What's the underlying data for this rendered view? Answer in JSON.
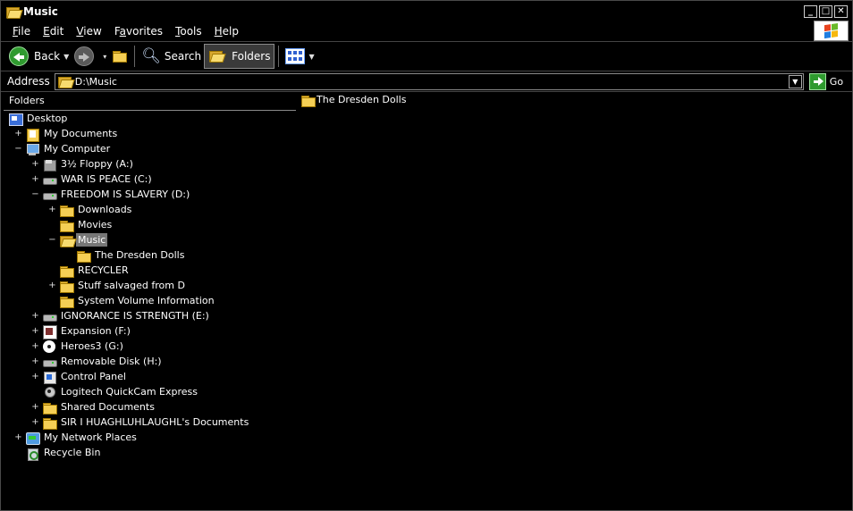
{
  "window": {
    "title": "Music"
  },
  "menu": [
    "File",
    "Edit",
    "View",
    "Favorites",
    "Tools",
    "Help"
  ],
  "menu_underline": [
    "F",
    "E",
    "V",
    "a",
    "T",
    "H"
  ],
  "toolbar": {
    "back": "Back",
    "search": "Search",
    "folders": "Folders"
  },
  "address": {
    "label": "Address",
    "value": "D:\\Music",
    "go": "Go"
  },
  "folders_pane": {
    "title": "Folders"
  },
  "tree": [
    {
      "label": "Desktop",
      "icon": "desktop-icon",
      "expander": ""
    },
    {
      "label": "My Documents",
      "icon": "my-documents-icon",
      "expander": "+"
    },
    {
      "label": "My Computer",
      "icon": "my-computer-icon",
      "expander": "−"
    },
    {
      "label": "3½ Floppy (A:)",
      "icon": "floppy-drive-icon",
      "expander": "+"
    },
    {
      "label": "WAR IS PEACE (C:)",
      "icon": "hard-drive-icon",
      "expander": "+"
    },
    {
      "label": "FREEDOM IS SLAVERY (D:)",
      "icon": "hard-drive-icon",
      "expander": "−"
    },
    {
      "label": "Downloads",
      "icon": "folder-icon",
      "expander": "+"
    },
    {
      "label": "Movies",
      "icon": "folder-icon",
      "expander": ""
    },
    {
      "label": "Music",
      "icon": "open-folder-icon",
      "expander": "−",
      "selected": true
    },
    {
      "label": "The Dresden Dolls",
      "icon": "folder-icon",
      "expander": ""
    },
    {
      "label": "RECYCLER",
      "icon": "folder-icon",
      "expander": ""
    },
    {
      "label": "Stuff salvaged from D",
      "icon": "folder-icon",
      "expander": "+"
    },
    {
      "label": "System Volume Information",
      "icon": "folder-icon",
      "expander": ""
    },
    {
      "label": "IGNORANCE IS STRENGTH (E:)",
      "icon": "hard-drive-icon",
      "expander": "+"
    },
    {
      "label": "Expansion (F:)",
      "icon": "game-disc-icon",
      "expander": "+"
    },
    {
      "label": "Heroes3 (G:)",
      "icon": "cd-drive-icon",
      "expander": "+"
    },
    {
      "label": "Removable Disk (H:)",
      "icon": "removable-disk-icon",
      "expander": "+"
    },
    {
      "label": "Control Panel",
      "icon": "control-panel-icon",
      "expander": "+"
    },
    {
      "label": "Logitech QuickCam Express",
      "icon": "webcam-icon",
      "expander": ""
    },
    {
      "label": "Shared Documents",
      "icon": "folder-icon",
      "expander": "+"
    },
    {
      "label": "SIR I HUAGHLUHLAUGHL's Documents",
      "icon": "folder-icon",
      "expander": "+"
    },
    {
      "label": "My Network Places",
      "icon": "network-places-icon",
      "expander": "+"
    },
    {
      "label": "Recycle Bin",
      "icon": "recycle-bin-icon",
      "expander": ""
    }
  ],
  "content": [
    {
      "label": "The Dresden Dolls",
      "icon": "folder-icon"
    }
  ]
}
